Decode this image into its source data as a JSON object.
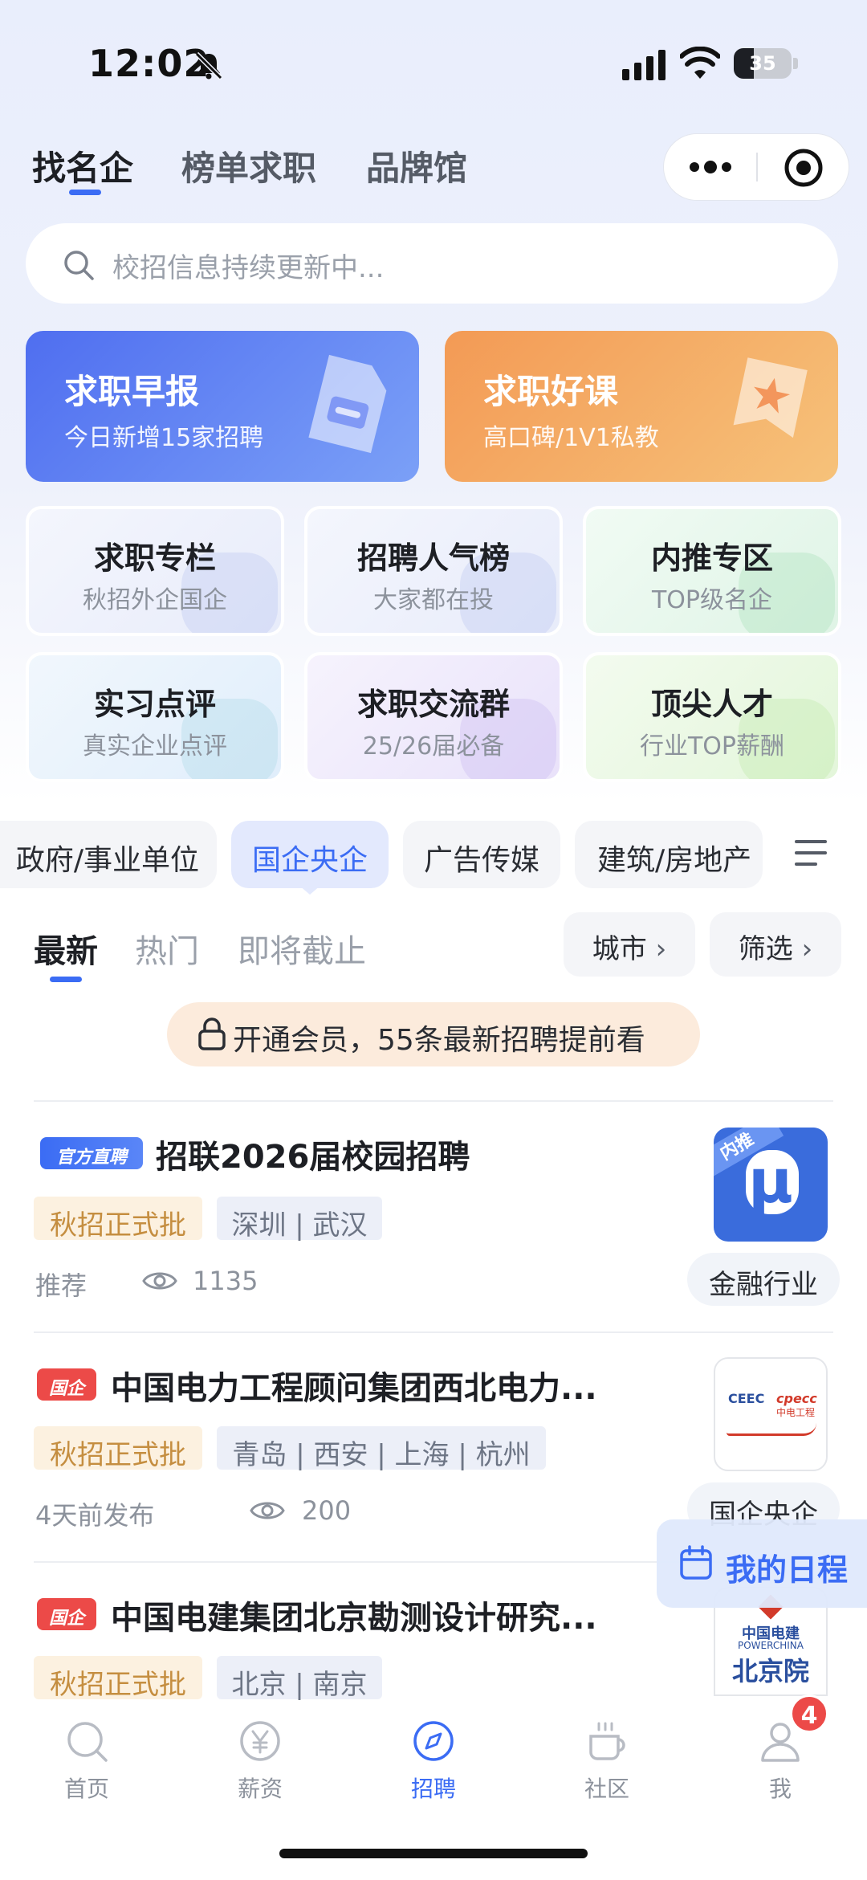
{
  "status_bar": {
    "time": "12:02",
    "battery": "35",
    "battery_level": 0.35
  },
  "top_tabs": [
    {
      "label": "找名企",
      "active": true
    },
    {
      "label": "榜单求职",
      "active": false
    },
    {
      "label": "品牌馆",
      "active": false
    }
  ],
  "search": {
    "placeholder": "校招信息持续更新中..."
  },
  "banners": [
    {
      "title": "求职早报",
      "subtitle": "今日新增15家招聘",
      "color": "#4f6ef0",
      "icon": "document-icon"
    },
    {
      "title": "求职好课",
      "subtitle": "高口碑/1V1私教",
      "color": "#f39a55",
      "icon": "star-ribbon-icon"
    }
  ],
  "grid": [
    {
      "title": "求职专栏",
      "subtitle": "秋招外企国企",
      "color": "#eef1fb"
    },
    {
      "title": "招聘人气榜",
      "subtitle": "大家都在投",
      "color": "#eef1fb"
    },
    {
      "title": "内推专区",
      "subtitle": "TOP级名企",
      "color": "#e9f8ee"
    },
    {
      "title": "实习点评",
      "subtitle": "真实企业点评",
      "color": "#eaf3fc"
    },
    {
      "title": "求职交流群",
      "subtitle": "25/26届必备",
      "color": "#f1ecfb"
    },
    {
      "title": "顶尖人才",
      "subtitle": "行业TOP薪酬",
      "color": "#edf8e7"
    }
  ],
  "categories": [
    {
      "label": "政府/事业单位",
      "active": false
    },
    {
      "label": "国企央企",
      "active": true
    },
    {
      "label": "广告传媒",
      "active": false
    },
    {
      "label": "建筑/房地产",
      "active": false
    }
  ],
  "sub_tabs": [
    {
      "label": "最新",
      "active": true
    },
    {
      "label": "热门",
      "active": false
    },
    {
      "label": "即将截止",
      "active": false
    }
  ],
  "filters": {
    "city": "城市",
    "filter": "筛选"
  },
  "vip_banner": "开通会员，55条最新招聘提前看",
  "jobs": [
    {
      "badge": "官方直聘",
      "title": "招联2026届校园招聘",
      "tags": [
        "秋招正式批",
        "深圳 | 武汉"
      ],
      "meta_left": "推荐",
      "views": "1135",
      "industry": "金融行业",
      "logo_tag": "内推",
      "logo_letter": "μ"
    },
    {
      "badge": "国企",
      "title": "中国电力工程顾问集团西北电力...",
      "tags": [
        "秋招正式批",
        "青岛 | 西安 | 上海 | 杭州"
      ],
      "meta_left": "4天前发布",
      "views": "200",
      "industry": "国企央企",
      "logo_line1": "CEEC",
      "logo_line2": "cpecc",
      "logo_line3": "中电工程"
    },
    {
      "badge": "国企",
      "title": "中国电建集团北京勘测设计研究...",
      "tags": [
        "秋招正式批",
        "北京 | 南京"
      ],
      "logo_line1": "中国电建",
      "logo_line2": "POWERCHINA",
      "logo_line3": "北京院"
    }
  ],
  "schedule_button": "我的日程",
  "bottom_nav": [
    {
      "label": "首页",
      "icon": "search-icon",
      "active": false
    },
    {
      "label": "薪资",
      "icon": "yen-icon",
      "active": false
    },
    {
      "label": "招聘",
      "icon": "compass-icon",
      "active": true
    },
    {
      "label": "社区",
      "icon": "coffee-icon",
      "active": false
    },
    {
      "label": "我",
      "icon": "user-icon",
      "active": false,
      "badge": "4"
    }
  ],
  "colors": {
    "accent": "#3b6cf4",
    "badge_red": "#ec4a48",
    "gold_tag": "#c58e40"
  }
}
